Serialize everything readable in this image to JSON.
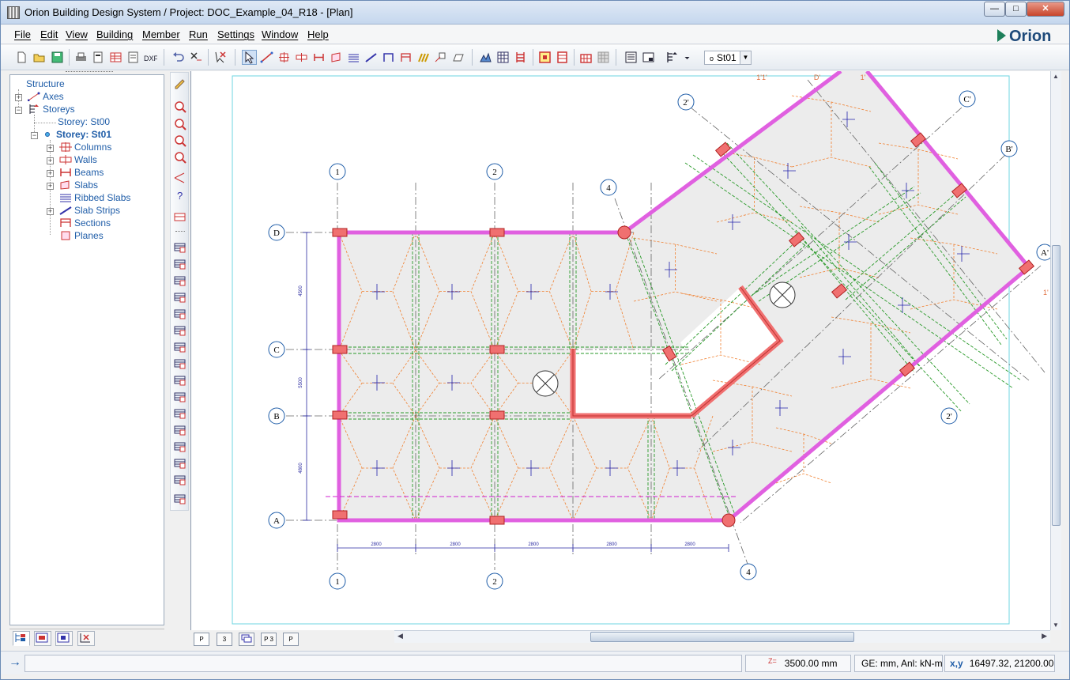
{
  "window": {
    "title": "Orion Building Design System / Project: DOC_Example_04_R18 - [Plan]"
  },
  "menu": [
    "File",
    "Edit",
    "View",
    "Building",
    "Member",
    "Run",
    "Settings",
    "Window",
    "Help"
  ],
  "brand": "Orion",
  "toolbar": {
    "storey_select": "St01"
  },
  "tree": {
    "root": "Structure",
    "axes": "Axes",
    "storeys": "Storeys",
    "storey_st00": "Storey: St00",
    "storey_st01": "Storey: St01",
    "children": [
      "Columns",
      "Walls",
      "Beams",
      "Slabs",
      "Ribbed Slabs",
      "Slab Strips",
      "Sections",
      "Planes"
    ]
  },
  "plan": {
    "axes_bubbles": [
      "1",
      "2",
      "1",
      "2",
      "4",
      "4",
      "D",
      "C",
      "B",
      "A",
      "2'",
      "C'",
      "B'",
      "A'",
      "2'"
    ],
    "top_labels": [
      "1'1'",
      "D'",
      "1'"
    ],
    "side_label": "1'",
    "vertical_dims": [
      "4500",
      "5500",
      "4800"
    ],
    "horizontal_dims": [
      "2800",
      "2800",
      "2800",
      "2800",
      "2800"
    ]
  },
  "view_tabs": [
    "P",
    "3",
    "",
    "P 3",
    "P"
  ],
  "status": {
    "z_label": "Z=",
    "elevation": "3500.00 mm",
    "units": "GE: mm, Anl: kN-m",
    "xy_label": "x,y",
    "coords": "16497.32, 21200.00"
  },
  "colors": {
    "slab": "#ececec",
    "beam_magenta": "#e060e0",
    "wall_red": "#f07070",
    "axis_blue": "#1f5da8",
    "yield_orange": "#f08030",
    "beam_green": "#2a9a2a"
  }
}
